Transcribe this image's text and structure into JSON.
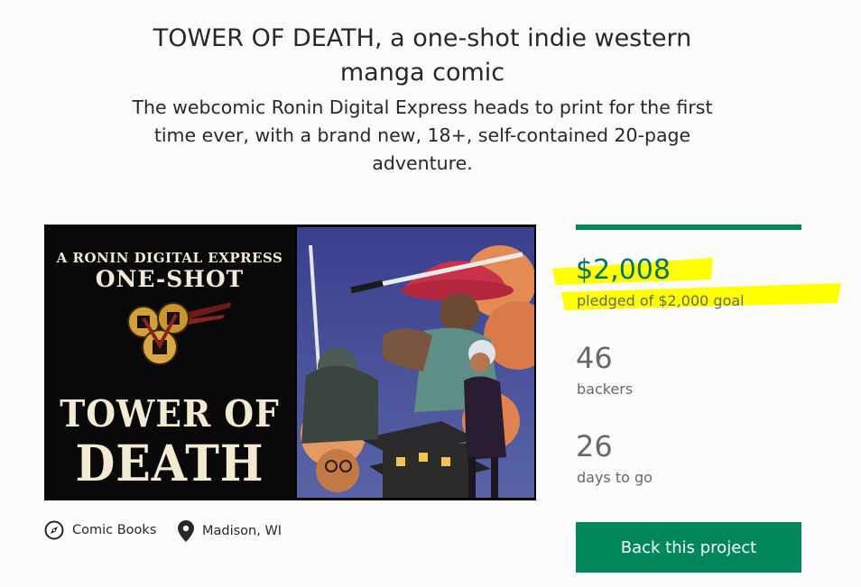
{
  "project": {
    "title": "TOWER OF DEATH, a one-shot indie western manga comic",
    "blurb": "The webcomic Ronin Digital Express heads to print for the first time ever, with a brand new, 18+, self-contained 20-page adventure."
  },
  "hero": {
    "kicker": "A RONIN DIGITAL EXPRESS",
    "oneshot": "ONE-SHOT",
    "title_line1": "TOWER OF",
    "title_line2": "DEATH"
  },
  "stats": {
    "pledged": "$2,008",
    "pledged_label": "pledged of $2,000 goal",
    "progress": 1.0,
    "backers": "46",
    "backers_label": "backers",
    "days": "26",
    "days_label": "days to go"
  },
  "cta": {
    "label": "Back this project"
  },
  "meta": {
    "category": "Comic Books",
    "category_icon": "compass-icon",
    "location": "Madison, WI",
    "location_icon": "location-pin-icon"
  },
  "colors": {
    "accent": "#028858",
    "pledged_text": "#037362",
    "highlight": "#ffff00",
    "muted_text": "#656969"
  }
}
